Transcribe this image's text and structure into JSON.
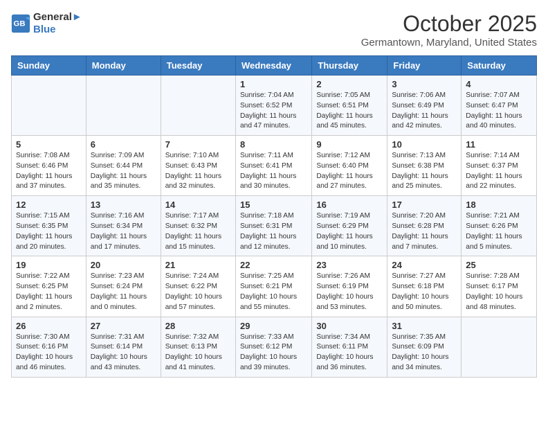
{
  "header": {
    "logo_line1": "General",
    "logo_line2": "Blue",
    "month": "October 2025",
    "location": "Germantown, Maryland, United States"
  },
  "weekdays": [
    "Sunday",
    "Monday",
    "Tuesday",
    "Wednesday",
    "Thursday",
    "Friday",
    "Saturday"
  ],
  "weeks": [
    [
      {
        "day": "",
        "info": ""
      },
      {
        "day": "",
        "info": ""
      },
      {
        "day": "",
        "info": ""
      },
      {
        "day": "1",
        "info": "Sunrise: 7:04 AM\nSunset: 6:52 PM\nDaylight: 11 hours and 47 minutes."
      },
      {
        "day": "2",
        "info": "Sunrise: 7:05 AM\nSunset: 6:51 PM\nDaylight: 11 hours and 45 minutes."
      },
      {
        "day": "3",
        "info": "Sunrise: 7:06 AM\nSunset: 6:49 PM\nDaylight: 11 hours and 42 minutes."
      },
      {
        "day": "4",
        "info": "Sunrise: 7:07 AM\nSunset: 6:47 PM\nDaylight: 11 hours and 40 minutes."
      }
    ],
    [
      {
        "day": "5",
        "info": "Sunrise: 7:08 AM\nSunset: 6:46 PM\nDaylight: 11 hours and 37 minutes."
      },
      {
        "day": "6",
        "info": "Sunrise: 7:09 AM\nSunset: 6:44 PM\nDaylight: 11 hours and 35 minutes."
      },
      {
        "day": "7",
        "info": "Sunrise: 7:10 AM\nSunset: 6:43 PM\nDaylight: 11 hours and 32 minutes."
      },
      {
        "day": "8",
        "info": "Sunrise: 7:11 AM\nSunset: 6:41 PM\nDaylight: 11 hours and 30 minutes."
      },
      {
        "day": "9",
        "info": "Sunrise: 7:12 AM\nSunset: 6:40 PM\nDaylight: 11 hours and 27 minutes."
      },
      {
        "day": "10",
        "info": "Sunrise: 7:13 AM\nSunset: 6:38 PM\nDaylight: 11 hours and 25 minutes."
      },
      {
        "day": "11",
        "info": "Sunrise: 7:14 AM\nSunset: 6:37 PM\nDaylight: 11 hours and 22 minutes."
      }
    ],
    [
      {
        "day": "12",
        "info": "Sunrise: 7:15 AM\nSunset: 6:35 PM\nDaylight: 11 hours and 20 minutes."
      },
      {
        "day": "13",
        "info": "Sunrise: 7:16 AM\nSunset: 6:34 PM\nDaylight: 11 hours and 17 minutes."
      },
      {
        "day": "14",
        "info": "Sunrise: 7:17 AM\nSunset: 6:32 PM\nDaylight: 11 hours and 15 minutes."
      },
      {
        "day": "15",
        "info": "Sunrise: 7:18 AM\nSunset: 6:31 PM\nDaylight: 11 hours and 12 minutes."
      },
      {
        "day": "16",
        "info": "Sunrise: 7:19 AM\nSunset: 6:29 PM\nDaylight: 11 hours and 10 minutes."
      },
      {
        "day": "17",
        "info": "Sunrise: 7:20 AM\nSunset: 6:28 PM\nDaylight: 11 hours and 7 minutes."
      },
      {
        "day": "18",
        "info": "Sunrise: 7:21 AM\nSunset: 6:26 PM\nDaylight: 11 hours and 5 minutes."
      }
    ],
    [
      {
        "day": "19",
        "info": "Sunrise: 7:22 AM\nSunset: 6:25 PM\nDaylight: 11 hours and 2 minutes."
      },
      {
        "day": "20",
        "info": "Sunrise: 7:23 AM\nSunset: 6:24 PM\nDaylight: 11 hours and 0 minutes."
      },
      {
        "day": "21",
        "info": "Sunrise: 7:24 AM\nSunset: 6:22 PM\nDaylight: 10 hours and 57 minutes."
      },
      {
        "day": "22",
        "info": "Sunrise: 7:25 AM\nSunset: 6:21 PM\nDaylight: 10 hours and 55 minutes."
      },
      {
        "day": "23",
        "info": "Sunrise: 7:26 AM\nSunset: 6:19 PM\nDaylight: 10 hours and 53 minutes."
      },
      {
        "day": "24",
        "info": "Sunrise: 7:27 AM\nSunset: 6:18 PM\nDaylight: 10 hours and 50 minutes."
      },
      {
        "day": "25",
        "info": "Sunrise: 7:28 AM\nSunset: 6:17 PM\nDaylight: 10 hours and 48 minutes."
      }
    ],
    [
      {
        "day": "26",
        "info": "Sunrise: 7:30 AM\nSunset: 6:16 PM\nDaylight: 10 hours and 46 minutes."
      },
      {
        "day": "27",
        "info": "Sunrise: 7:31 AM\nSunset: 6:14 PM\nDaylight: 10 hours and 43 minutes."
      },
      {
        "day": "28",
        "info": "Sunrise: 7:32 AM\nSunset: 6:13 PM\nDaylight: 10 hours and 41 minutes."
      },
      {
        "day": "29",
        "info": "Sunrise: 7:33 AM\nSunset: 6:12 PM\nDaylight: 10 hours and 39 minutes."
      },
      {
        "day": "30",
        "info": "Sunrise: 7:34 AM\nSunset: 6:11 PM\nDaylight: 10 hours and 36 minutes."
      },
      {
        "day": "31",
        "info": "Sunrise: 7:35 AM\nSunset: 6:09 PM\nDaylight: 10 hours and 34 minutes."
      },
      {
        "day": "",
        "info": ""
      }
    ]
  ]
}
